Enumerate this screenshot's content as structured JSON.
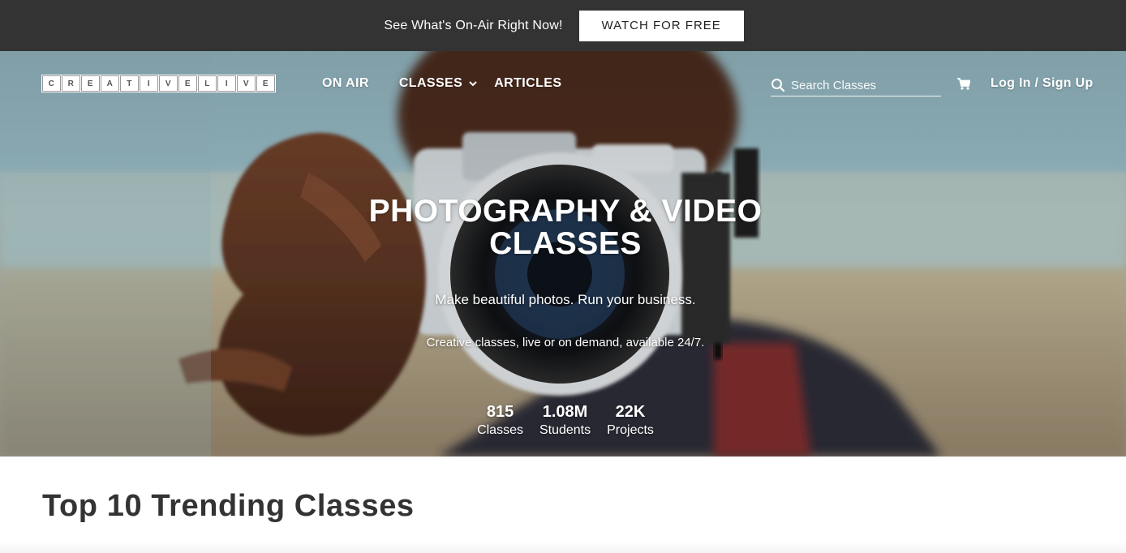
{
  "promo": {
    "text": "See What's On-Air Right Now!",
    "button_label": "WATCH FOR FREE"
  },
  "logo": {
    "letters": [
      "C",
      "R",
      "E",
      "A",
      "T",
      "I",
      "V",
      "E",
      "L",
      "I",
      "V",
      "E"
    ]
  },
  "nav": {
    "on_air": "ON AIR",
    "classes": "CLASSES",
    "articles": "ARTICLES"
  },
  "search": {
    "placeholder": "Search Classes"
  },
  "account": {
    "login_label": "Log In / Sign Up"
  },
  "hero": {
    "title_line1": "PHOTOGRAPHY & VIDEO",
    "title_line2": "CLASSES",
    "subtitle": "Make beautiful photos. Run your business.",
    "tagline": "Creative classes, live or on demand, available 24/7.",
    "stats": [
      {
        "value": "815",
        "label": "Classes"
      },
      {
        "value": "1.08M",
        "label": "Students"
      },
      {
        "value": "22K",
        "label": "Projects"
      }
    ]
  },
  "section": {
    "title": "Top 10 Trending Classes"
  },
  "colors": {
    "promo_bg": "#333333",
    "text_on_hero": "#ffffff",
    "heading": "#333333"
  }
}
